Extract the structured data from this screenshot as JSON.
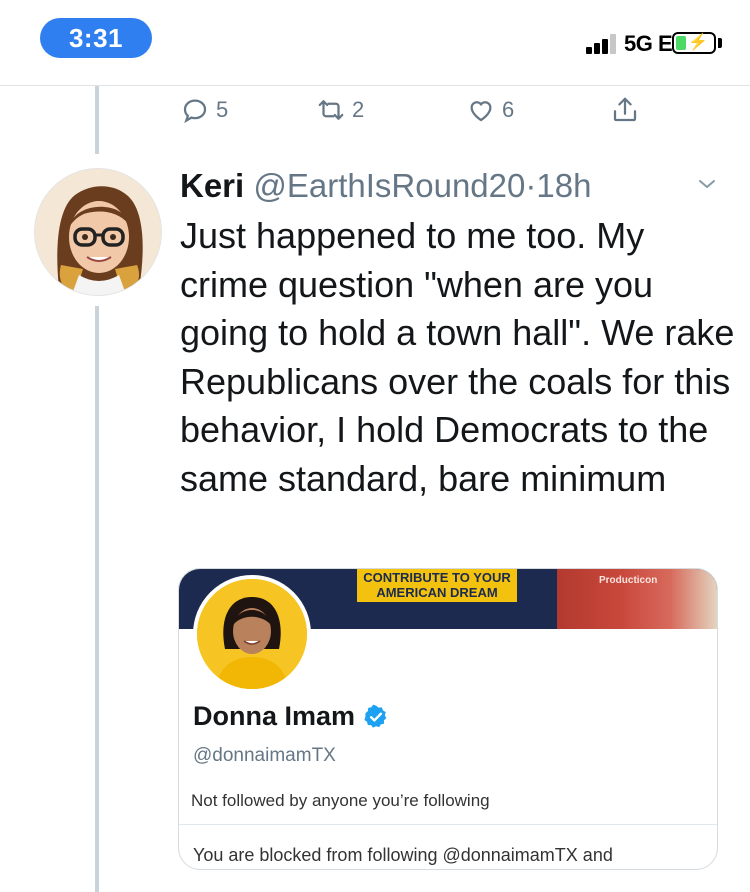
{
  "status_bar": {
    "time": "3:31",
    "network": "5G E",
    "battery_charging": true
  },
  "actions": {
    "reply_count": "5",
    "retweet_count": "2",
    "like_count": "6"
  },
  "tweet": {
    "name": "Keri",
    "handle": "@EarthIsRound20",
    "separator": "·",
    "time": "18h",
    "text": "Just happened to me too. My crime question \"when are you going to hold a town hall\". We rake Republicans over the coals for this behavior, I hold Democrats to the same standard, bare minimum"
  },
  "embedded_profile": {
    "banner_text": "CONTRIBUTE TO YOUR AMERICAN DREAM",
    "banner_logo": "Producticon",
    "name": "Donna Imam",
    "handle": "@donnaimamTX",
    "follow_status": "Not followed by anyone you’re following",
    "blocked_text": "You are blocked from following @donnaimamTX and"
  },
  "colors": {
    "accent": "#2f7ff0",
    "muted": "#657786",
    "verified": "#1da1f2"
  }
}
